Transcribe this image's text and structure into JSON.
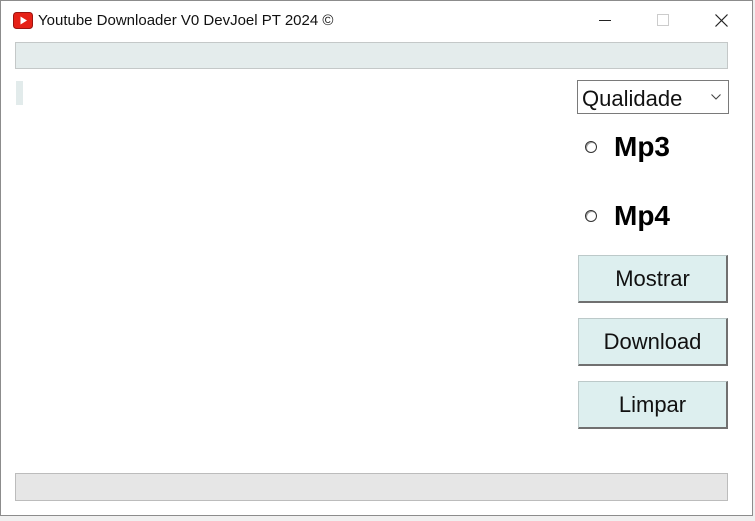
{
  "window": {
    "title": "Youtube Downloader V0 DevJoel PT 2024 ©",
    "app_icon": "youtube-icon",
    "controls": [
      "minimize-icon",
      "maximize-icon",
      "close-icon"
    ]
  },
  "url_input": {
    "value": "",
    "placeholder": ""
  },
  "info_label": {
    "text": ""
  },
  "quality": {
    "selected": "Qualidade"
  },
  "format": {
    "options": [
      {
        "label": "Mp3",
        "checked": false
      },
      {
        "label": "Mp4",
        "checked": false
      }
    ]
  },
  "buttons": {
    "show_label": "Mostrar",
    "download_label": "Download",
    "clear_label": "Limpar"
  },
  "progress": {
    "value": 0
  },
  "colors": {
    "button_bg": "#ddefef",
    "input_bg": "#e4ecec",
    "youtube_red": "#e62117"
  }
}
